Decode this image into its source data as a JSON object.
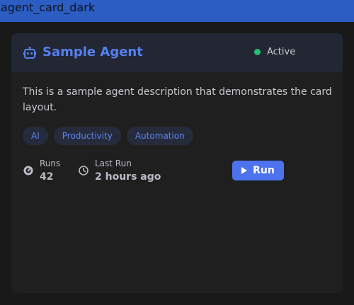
{
  "window": {
    "title": "agent_card_dark"
  },
  "card": {
    "title": "Sample Agent",
    "icon": "robot-icon",
    "status": {
      "label": "Active",
      "color": "#22c074"
    },
    "description": "This is a sample agent description that demonstrates the card layout.",
    "tags": [
      "AI",
      "Productivity",
      "Automation"
    ],
    "stats": {
      "runs": {
        "label": "Runs",
        "value": "42",
        "icon": "runs-gauge-icon"
      },
      "last_run": {
        "label": "Last Run",
        "value": "2 hours ago",
        "icon": "clock-icon"
      }
    },
    "run_button": {
      "label": "Run",
      "icon": "play-icon"
    }
  },
  "colors": {
    "accent": "#4d72ee",
    "title_bar": "#2b5dc2",
    "card_bg": "#1f1f1f",
    "header_bg": "#232734",
    "tag_bg": "#262b3b"
  }
}
